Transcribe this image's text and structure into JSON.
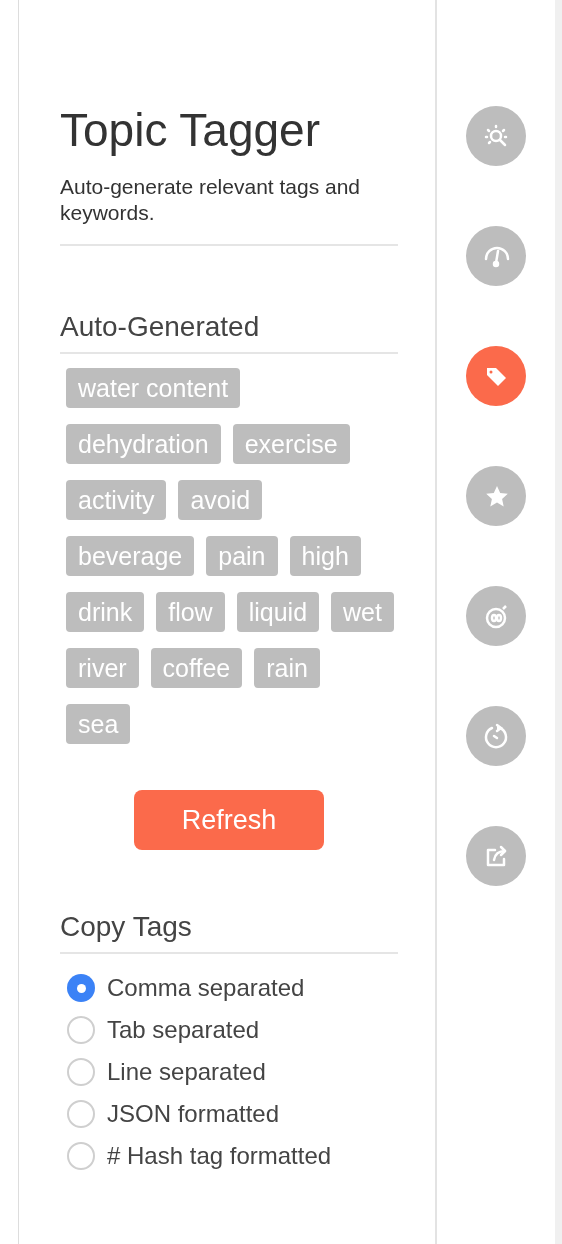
{
  "panel": {
    "title": "Topic Tagger",
    "subtitle": "Auto-generate relevant tags and keywords."
  },
  "auto_generated": {
    "heading": "Auto-Generated",
    "tags": [
      "water content",
      "dehydration",
      "exercise",
      "activity",
      "avoid",
      "beverage",
      "pain",
      "high",
      "drink",
      "flow",
      "liquid",
      "wet",
      "river",
      "coffee",
      "rain",
      "sea"
    ],
    "refresh_button": "Refresh"
  },
  "copy_tags": {
    "heading": "Copy Tags",
    "options": [
      {
        "label": "Comma separated",
        "selected": true
      },
      {
        "label": "Tab separated",
        "selected": false
      },
      {
        "label": "Line separated",
        "selected": false
      },
      {
        "label": "JSON formatted",
        "selected": false
      },
      {
        "label": "# Hash tag formatted",
        "selected": false
      }
    ]
  },
  "sidebar": {
    "items": [
      {
        "kind": "insight",
        "selected": false
      },
      {
        "kind": "gauge",
        "selected": false
      },
      {
        "kind": "tag",
        "selected": true
      },
      {
        "kind": "star",
        "selected": false
      },
      {
        "kind": "stopwatch",
        "selected": false
      },
      {
        "kind": "history",
        "selected": false
      },
      {
        "kind": "share",
        "selected": false
      }
    ]
  }
}
